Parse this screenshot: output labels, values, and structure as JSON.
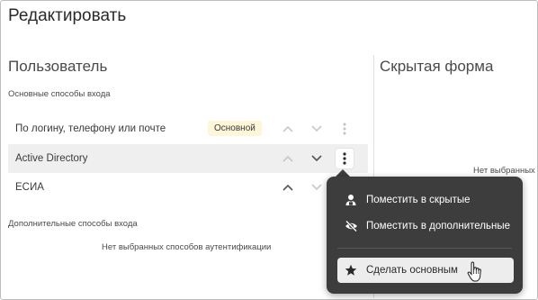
{
  "page": {
    "title": "Редактировать"
  },
  "user_section": {
    "title": "Пользователь",
    "primary_label": "Основные способы входа",
    "methods": [
      {
        "label": "По логину, телефону или почте",
        "badge": "Основной"
      },
      {
        "label": "Active Directory"
      },
      {
        "label": "ЕСИА"
      }
    ],
    "additional_label": "Дополнительные способы входа",
    "additional_empty": "Нет выбранных способов аутентификации"
  },
  "hidden_section": {
    "title": "Скрытая форма",
    "empty_partial": "Нет выбранных"
  },
  "context_menu": {
    "items": [
      {
        "label": "Поместить в скрытые",
        "icon": "user-hide-icon"
      },
      {
        "label": "Поместить в дополнительные",
        "icon": "eye-off-icon"
      },
      {
        "label": "Сделать основным",
        "icon": "star-icon"
      }
    ]
  },
  "colors": {
    "menu_bg": "#3d3d3d",
    "badge_bg": "#fdf6d8",
    "row_highlight": "#efefef"
  }
}
